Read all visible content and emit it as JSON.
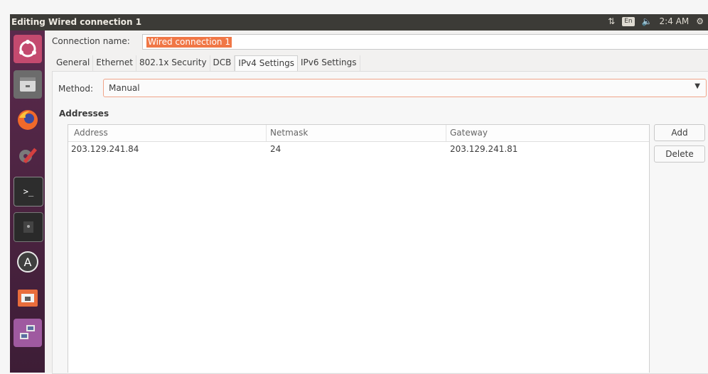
{
  "window": {
    "title": "Editing Wired connection 1"
  },
  "tray": {
    "kbd_layout": "En",
    "clock": "2:4 AM"
  },
  "launcher": {
    "items": [
      {
        "name": "ubuntu-dash-icon"
      },
      {
        "name": "file-cabinet-icon"
      },
      {
        "name": "firefox-icon"
      },
      {
        "name": "settings-tools-icon"
      },
      {
        "name": "terminal-icon"
      },
      {
        "name": "lock-box-icon"
      },
      {
        "name": "software-updater-icon"
      },
      {
        "name": "file-manager-icon"
      },
      {
        "name": "network-connections-icon"
      }
    ]
  },
  "connection": {
    "label": "Connection name:",
    "value": "Wired connection 1"
  },
  "tabs": [
    {
      "label": "General"
    },
    {
      "label": "Ethernet"
    },
    {
      "label": "802.1x Security"
    },
    {
      "label": "DCB"
    },
    {
      "label": "IPv4 Settings"
    },
    {
      "label": "IPv6 Settings"
    }
  ],
  "active_tab": "IPv4 Settings",
  "method": {
    "label": "Method:",
    "value": "Manual"
  },
  "addresses": {
    "title": "Addresses",
    "columns": [
      "Address",
      "Netmask",
      "Gateway"
    ],
    "rows": [
      [
        "203.129.241.84",
        "24",
        "203.129.241.81"
      ]
    ]
  },
  "buttons": {
    "add": "Add",
    "delete": "Delete"
  },
  "colors": {
    "accent": "#f07746",
    "panel": "#3c3b37",
    "launcher": "#4a2440"
  }
}
